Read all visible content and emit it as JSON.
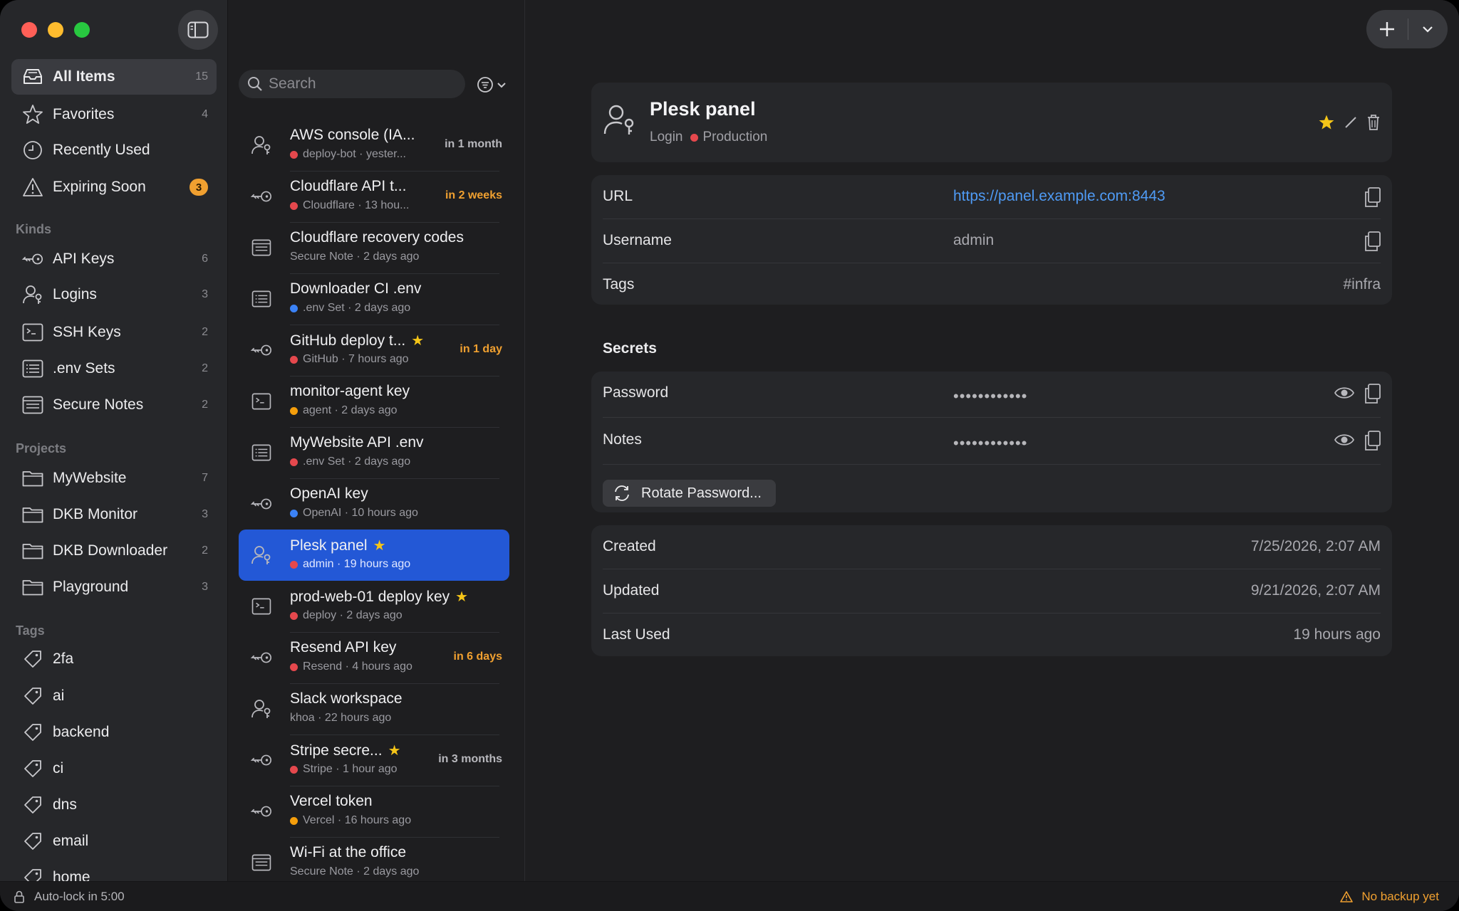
{
  "sidebar": {
    "items": [
      {
        "label": "All Items",
        "count": "15",
        "icon": "inbox-icon"
      },
      {
        "label": "Favorites",
        "count": "4",
        "icon": "star-icon"
      },
      {
        "label": "Recently Used",
        "count": "",
        "icon": "clock-icon"
      },
      {
        "label": "Expiring Soon",
        "badge": "3",
        "icon": "warning-icon"
      }
    ],
    "kinds_title": "Kinds",
    "kinds": [
      {
        "label": "API Keys",
        "count": "6",
        "icon": "key-icon"
      },
      {
        "label": "Logins",
        "count": "3",
        "icon": "person-key-icon"
      },
      {
        "label": "SSH Keys",
        "count": "2",
        "icon": "terminal-icon"
      },
      {
        "label": ".env Sets",
        "count": "2",
        "icon": "list-icon"
      },
      {
        "label": "Secure Notes",
        "count": "2",
        "icon": "note-icon"
      }
    ],
    "projects_title": "Projects",
    "projects": [
      {
        "label": "MyWebsite",
        "count": "7"
      },
      {
        "label": "DKB Monitor",
        "count": "3"
      },
      {
        "label": "DKB Downloader",
        "count": "2"
      },
      {
        "label": "Playground",
        "count": "3"
      }
    ],
    "tags_title": "Tags",
    "tags": [
      "2fa",
      "ai",
      "backend",
      "ci",
      "dns",
      "email",
      "home"
    ]
  },
  "status": {
    "autolock": "Auto-lock in 5:00",
    "backup": "No backup yet"
  },
  "search": {
    "placeholder": "Search"
  },
  "colors": {
    "red": "#e5484d",
    "blue": "#3b82f6",
    "orange": "#f59e0b",
    "accent": "#2358d6",
    "warning": "#f0a030"
  },
  "list": [
    {
      "title": "AWS console (IA...",
      "dot": "red",
      "sub": "deploy-bot · yester...",
      "exp": "in 1 month",
      "exp_color": "#b8b8bd",
      "icon": "person-key-icon",
      "star": false
    },
    {
      "title": "Cloudflare API t...",
      "dot": "red",
      "sub": "Cloudflare · 13 hou...",
      "exp": "in 2 weeks",
      "exp_color": "#f0a030",
      "icon": "key-icon",
      "star": false
    },
    {
      "title": "Cloudflare recovery codes",
      "dot": "",
      "sub": "Secure Note · 2 days ago",
      "exp": "",
      "icon": "note-icon",
      "star": false
    },
    {
      "title": "Downloader CI .env",
      "dot": "blue",
      "sub": ".env Set · 2 days ago",
      "exp": "",
      "icon": "list-icon",
      "star": false
    },
    {
      "title": "GitHub deploy t...",
      "dot": "red",
      "sub": "GitHub · 7 hours ago",
      "exp": "in 1 day",
      "exp_color": "#f0a030",
      "icon": "key-icon",
      "star": true
    },
    {
      "title": "monitor-agent key",
      "dot": "orange",
      "sub": "agent · 2 days ago",
      "exp": "",
      "icon": "terminal-icon",
      "star": false
    },
    {
      "title": "MyWebsite API .env",
      "dot": "red",
      "sub": ".env Set · 2 days ago",
      "exp": "",
      "icon": "list-icon",
      "star": false
    },
    {
      "title": "OpenAI key",
      "dot": "blue",
      "sub": "OpenAI · 10 hours ago",
      "exp": "",
      "icon": "key-icon",
      "star": false
    },
    {
      "title": "Plesk panel",
      "dot": "red",
      "sub": "admin · 19 hours ago",
      "exp": "",
      "icon": "person-key-icon",
      "star": true,
      "selected": true
    },
    {
      "title": "prod-web-01 deploy key",
      "dot": "red",
      "sub": "deploy · 2 days ago",
      "exp": "",
      "icon": "terminal-icon",
      "star": true
    },
    {
      "title": "Resend API key",
      "dot": "red",
      "sub": "Resend · 4 hours ago",
      "exp": "in 6 days",
      "exp_color": "#f0a030",
      "icon": "key-icon",
      "star": false
    },
    {
      "title": "Slack workspace",
      "dot": "",
      "sub": "khoa · 22 hours ago",
      "exp": "",
      "icon": "person-key-icon",
      "star": false
    },
    {
      "title": "Stripe secre...",
      "dot": "red",
      "sub": "Stripe · 1 hour ago",
      "exp": "in 3 months",
      "exp_color": "#b8b8bd",
      "icon": "key-icon",
      "star": true
    },
    {
      "title": "Vercel token",
      "dot": "orange",
      "sub": "Vercel · 16 hours ago",
      "exp": "",
      "icon": "key-icon",
      "star": false
    },
    {
      "title": "Wi-Fi at the office",
      "dot": "",
      "sub": "Secure Note · 2 days ago",
      "exp": "",
      "icon": "note-icon",
      "star": false
    }
  ],
  "detail": {
    "title": "Plesk panel",
    "kind": "Login",
    "project": "Production",
    "fields": {
      "url_label": "URL",
      "url_value": "https://panel.example.com:8443",
      "username_label": "Username",
      "username_value": "admin",
      "tags_label": "Tags",
      "tags_value": "#infra"
    },
    "secrets_title": "Secrets",
    "secrets": {
      "password_label": "Password",
      "password_mask": "••••••••••••",
      "notes_label": "Notes",
      "notes_mask": "••••••••••••",
      "rotate_label": "Rotate Password..."
    },
    "meta": {
      "created_label": "Created",
      "created_value": "7/25/2026, 2:07 AM",
      "updated_label": "Updated",
      "updated_value": "9/21/2026, 2:07 AM",
      "lastused_label": "Last Used",
      "lastused_value": "19 hours ago"
    }
  }
}
